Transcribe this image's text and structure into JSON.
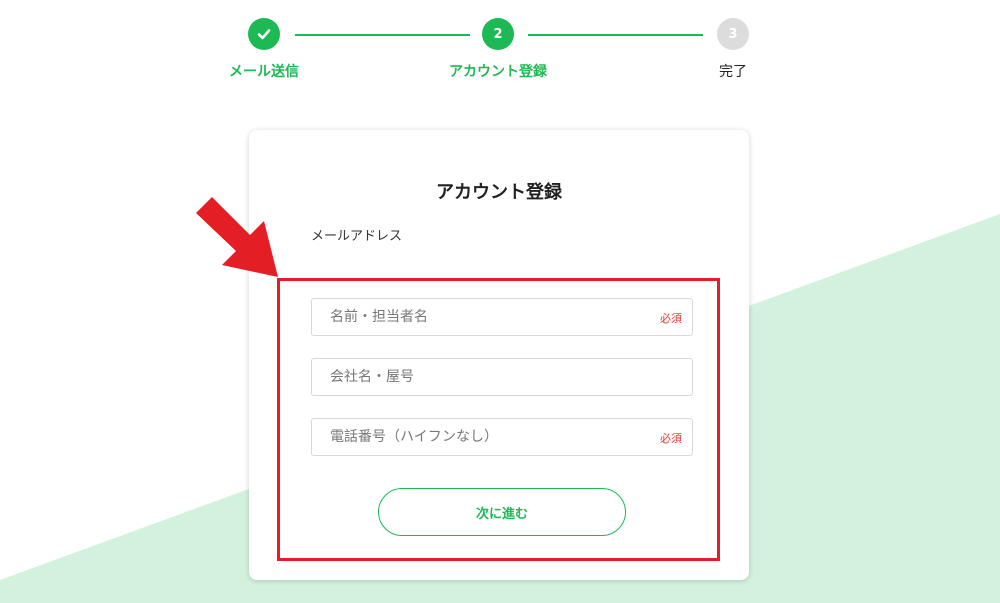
{
  "colors": {
    "accent": "#1db954",
    "inactive_step": "#dcdcdc",
    "required": "#e53935",
    "annotation": "#e31e24",
    "background_band": "#d3f2de"
  },
  "stepper": {
    "steps": [
      {
        "number": "",
        "label": "メール送信",
        "state": "done",
        "icon": "check-icon"
      },
      {
        "number": "2",
        "label": "アカウント登録",
        "state": "active"
      },
      {
        "number": "3",
        "label": "完了",
        "state": "pending"
      }
    ]
  },
  "form": {
    "title": "アカウント登録",
    "email_label": "メールアドレス",
    "fields": [
      {
        "placeholder": "名前・担当者名",
        "value": "",
        "required_badge": "必須"
      },
      {
        "placeholder": "会社名・屋号",
        "value": "",
        "required_badge": ""
      },
      {
        "placeholder": "電話番号（ハイフンなし）",
        "value": "",
        "required_badge": "必須"
      }
    ],
    "next_button_label": "次に進む"
  },
  "annotation": {
    "arrow_icon": "arrow-down-right-icon"
  }
}
